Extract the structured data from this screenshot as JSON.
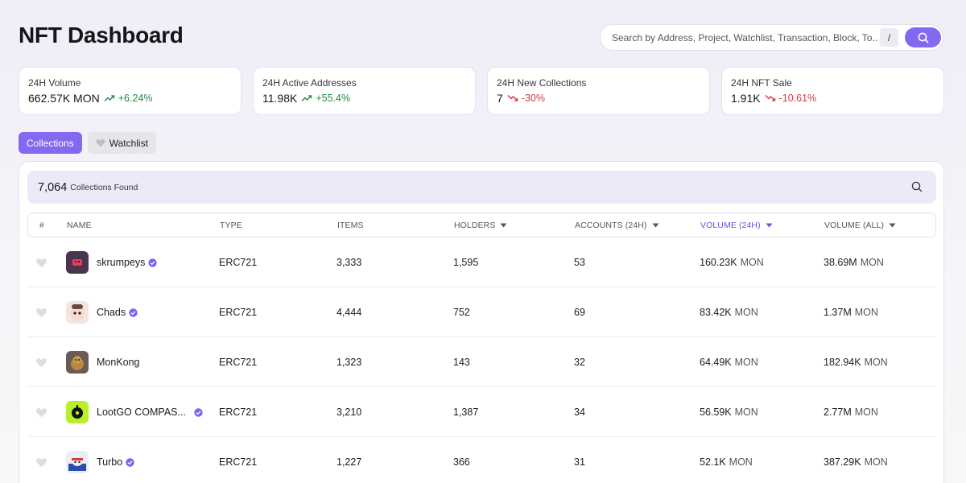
{
  "page_title": "NFT Dashboard",
  "search": {
    "placeholder": "Search by Address, Project, Watchlist, Transaction, Block, To...",
    "shortcut": "/"
  },
  "stats": [
    {
      "label": "24H Volume",
      "value": "662.57K MON",
      "change": "+6.24%",
      "trend": "up"
    },
    {
      "label": "24H Active Addresses",
      "value": "11.98K",
      "change": "+55.4%",
      "trend": "up"
    },
    {
      "label": "24H New Collections",
      "value": "7",
      "change": "-30%",
      "trend": "down"
    },
    {
      "label": "24H NFT Sale",
      "value": "1.91K",
      "change": "-10.61%",
      "trend": "down"
    }
  ],
  "tabs": {
    "collections": "Collections",
    "watchlist": "Watchlist"
  },
  "found": {
    "count": "7,064",
    "label": "Collections Found"
  },
  "columns": {
    "index": "#",
    "name": "NAME",
    "type": "TYPE",
    "items": "ITEMS",
    "holders": "HOLDERS",
    "accounts": "ACCOUNTS (24H)",
    "volume24": "VOLUME (24H)",
    "volumeAll": "VOLUME (ALL)"
  },
  "unit": "MON",
  "colors": {
    "accent": "#8469f0",
    "up": "#1f8a4c",
    "down": "#d23a3a"
  },
  "rows": [
    {
      "name": "skrumpeys",
      "verified": true,
      "type": "ERC721",
      "items": "3,333",
      "holders": "1,595",
      "accounts": "53",
      "volume24": "160.23K",
      "volumeAll": "38.69M"
    },
    {
      "name": "Chads",
      "verified": true,
      "type": "ERC721",
      "items": "4,444",
      "holders": "752",
      "accounts": "69",
      "volume24": "83.42K",
      "volumeAll": "1.37M"
    },
    {
      "name": "MonKong",
      "verified": false,
      "type": "ERC721",
      "items": "1,323",
      "holders": "143",
      "accounts": "32",
      "volume24": "64.49K",
      "volumeAll": "182.94K"
    },
    {
      "name": "LootGO COMPAS...",
      "verified": true,
      "type": "ERC721",
      "items": "3,210",
      "holders": "1,387",
      "accounts": "34",
      "volume24": "56.59K",
      "volumeAll": "2.77M"
    },
    {
      "name": "Turbo",
      "verified": true,
      "type": "ERC721",
      "items": "1,227",
      "holders": "366",
      "accounts": "31",
      "volume24": "52.1K",
      "volumeAll": "387.29K"
    }
  ]
}
